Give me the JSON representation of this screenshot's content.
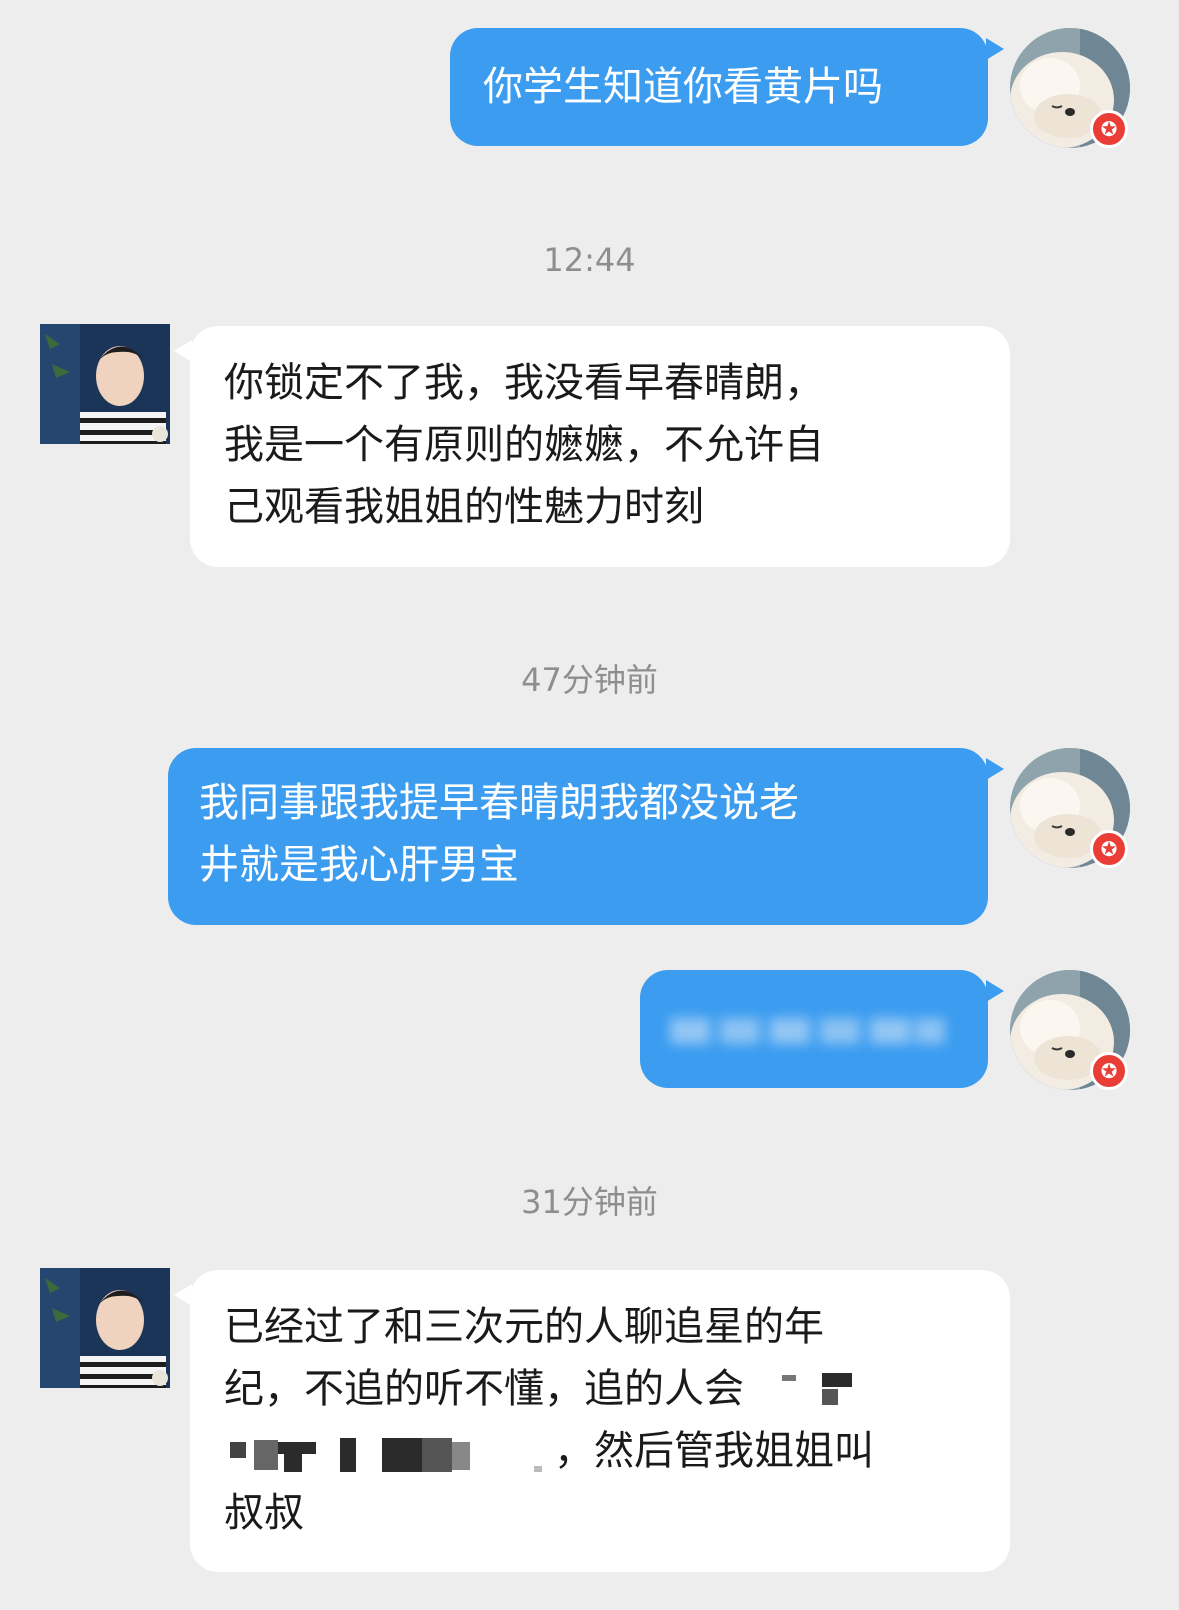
{
  "timestamps": [
    "12:44",
    "47分钟前",
    "31分钟前"
  ],
  "messages": [
    {
      "direction": "out",
      "lines": [
        "你学生知道你看黄片吗"
      ]
    },
    {
      "direction": "in",
      "lines": [
        "你锁定不了我，我没看早春晴朗，",
        "我是一个有原则的嬷嬷，不允许自",
        "己观看我姐姐的性魅力时刻"
      ]
    },
    {
      "direction": "out",
      "lines": [
        "我同事跟我提早春晴朗我都没说老",
        "井就是我心肝男宝"
      ]
    },
    {
      "direction": "out",
      "lines": [],
      "content": "blurred"
    },
    {
      "direction": "in",
      "lines": [
        "已经过了和三次元的人聊追星的年",
        "纪，不追的听不懂，追的人会",
        "，然后管我姐姐叫",
        "叔叔"
      ]
    }
  ],
  "colors": {
    "outgoing_bubble": "#3b9cf0",
    "incoming_bubble": "#ffffff",
    "background": "#ededed",
    "badge": "#ea3d36"
  },
  "icons": {
    "self_avatar": "pomeranian-dog-avatar",
    "contact_avatar": "person-photo-avatar",
    "badge": "star-badge-icon"
  }
}
